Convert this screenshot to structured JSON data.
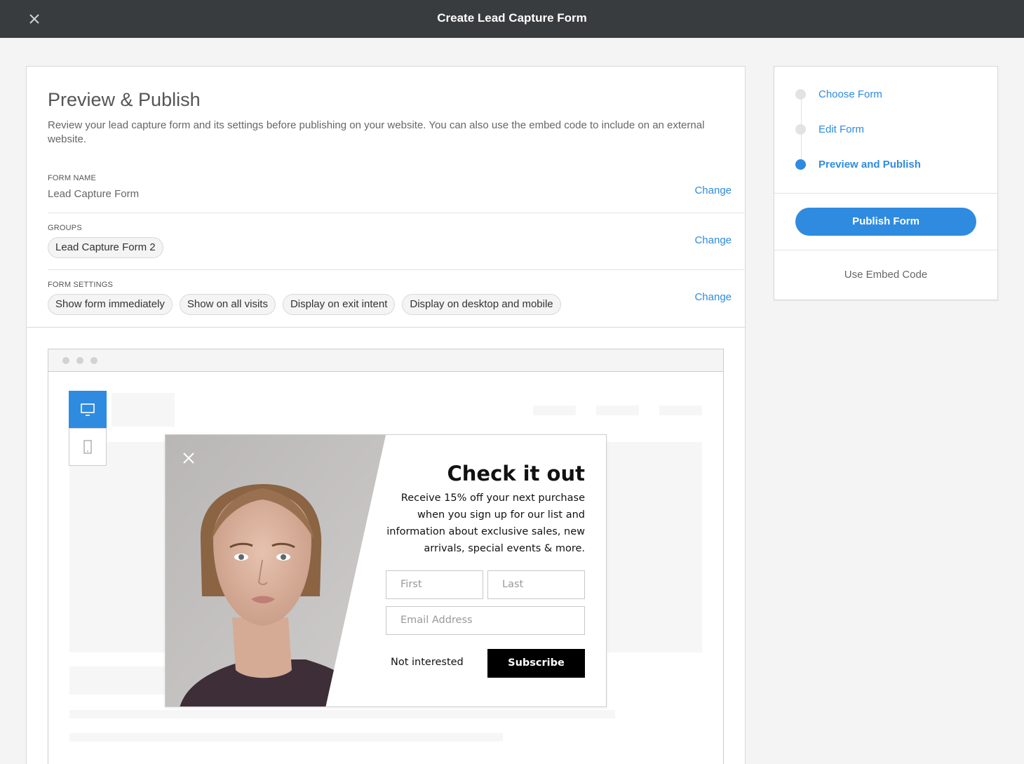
{
  "header": {
    "title": "Create Lead Capture Form",
    "close_icon": "close-icon"
  },
  "main": {
    "heading": "Preview & Publish",
    "description": "Review your lead capture form and its settings before publishing on your website. You can also use the embed code to include on an external website.",
    "form_name": {
      "label": "FORM NAME",
      "value": "Lead Capture Form",
      "change": "Change"
    },
    "groups": {
      "label": "GROUPS",
      "pills": [
        "Lead Capture Form 2"
      ],
      "change": "Change"
    },
    "form_settings": {
      "label": "FORM SETTINGS",
      "pills": [
        "Show form immediately",
        "Show on all visits",
        "Display on exit intent",
        "Display on desktop and mobile"
      ],
      "change": "Change"
    }
  },
  "preview": {
    "device_toggle": {
      "selected": "desktop",
      "icons": [
        "desktop-icon",
        "mobile-icon"
      ]
    },
    "popup": {
      "title": "Check it out",
      "text": "Receive 15% off your next purchase when you sign up for our list and information about exclusive sales, new arrivals, special events & more.",
      "first_placeholder": "First",
      "last_placeholder": "Last",
      "email_placeholder": "Email Address",
      "not_interested": "Not interested",
      "subscribe": "Subscribe"
    }
  },
  "sidebar": {
    "steps": [
      {
        "label": "Choose Form",
        "active": false
      },
      {
        "label": "Edit Form",
        "active": false
      },
      {
        "label": "Preview and Publish",
        "active": true
      }
    ],
    "publish_button": "Publish Form",
    "embed_link": "Use Embed Code"
  },
  "colors": {
    "accent": "#2e8be0",
    "topbar": "#383c3f",
    "background": "#f4f4f4"
  }
}
